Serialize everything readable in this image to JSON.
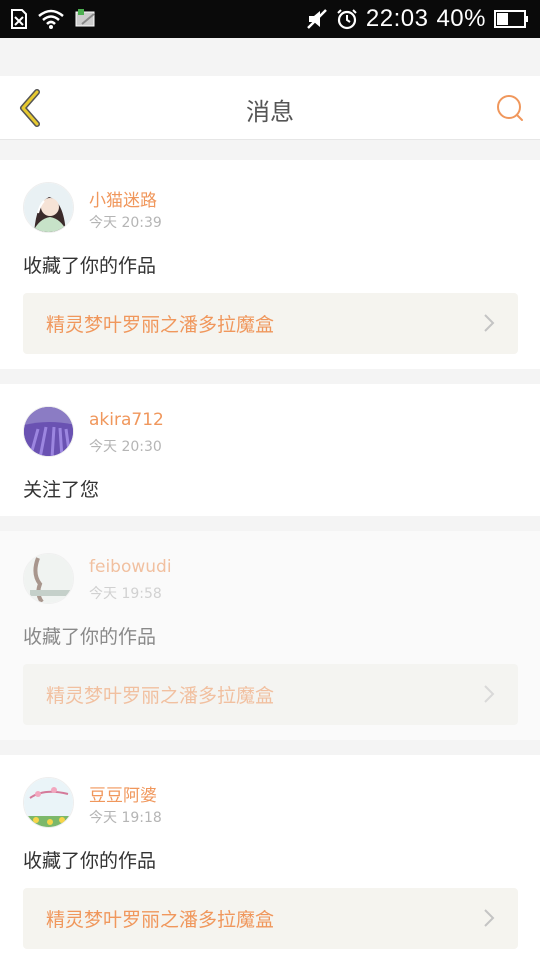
{
  "status_bar": {
    "time": "22:03",
    "battery": "40%"
  },
  "header": {
    "title": "消息"
  },
  "messages": [
    {
      "username": "小猫迷路",
      "time": "今天 20:39",
      "action": "收藏了你的作品",
      "work_title": "精灵梦叶罗丽之潘多拉魔盒",
      "read": false
    },
    {
      "username": "akira712",
      "time": "今天 20:30",
      "action": "关注了您",
      "read": false
    },
    {
      "username": "feibowudi",
      "time": "今天 19:58",
      "action": "收藏了你的作品",
      "work_title": "精灵梦叶罗丽之潘多拉魔盒",
      "read": true
    },
    {
      "username": "豆豆阿婆",
      "time": "今天 19:18",
      "action": "收藏了你的作品",
      "work_title": "精灵梦叶罗丽之潘多拉魔盒",
      "read": false
    }
  ],
  "colors": {
    "accent": "#f0975c",
    "back_arrow": "#e6c930",
    "link_bg": "#f5f4ef"
  }
}
